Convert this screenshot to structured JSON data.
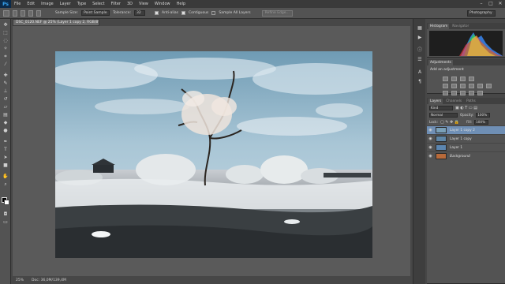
{
  "app": {
    "logo": "Ps"
  },
  "menu": [
    "File",
    "Edit",
    "Image",
    "Layer",
    "Type",
    "Select",
    "Filter",
    "3D",
    "View",
    "Window",
    "Help"
  ],
  "window_controls": {
    "minimize": "–",
    "maximize": "□",
    "close": "✕"
  },
  "options_bar": {
    "sample_size_label": "Sample Size:",
    "sample_size_value": "Point Sample",
    "tolerance_label": "Tolerance:",
    "tolerance_value": "32",
    "anti_alias_label": "Anti-alias",
    "anti_alias_checked": true,
    "contiguous_label": "Contiguous",
    "contiguous_checked": true,
    "sample_all_layers_label": "Sample All Layers",
    "sample_all_layers_checked": false,
    "refine_edge_label": "Refine Edge...",
    "workspace": "Photography"
  },
  "document": {
    "tab_title": "DSC_0120.NEF @ 25% (Layer 1 copy 2, RGB/8*) *",
    "zoom": "25%",
    "doc_size": "Doc: 36,0M/139,4M"
  },
  "panels": {
    "histogram_tab": "Histogram",
    "navigator_tab": "Navigator",
    "adjustments_tab": "Adjustments",
    "add_adjustment": "Add an adjustment",
    "layers_tab": "Layers",
    "channels_tab": "Channels",
    "paths_tab": "Paths",
    "filter_kind": "Kind",
    "blend_mode": "Normal",
    "opacity_label": "Opacity:",
    "opacity_value": "100%",
    "lock_label": "Lock:",
    "fill_label": "Fill:",
    "fill_value": "100%"
  },
  "layers": [
    {
      "name": "Layer 1 copy 2",
      "selected": true,
      "thumb": "#7aa0b8",
      "italic": false
    },
    {
      "name": "Layer 1 copy",
      "selected": false,
      "thumb": "#5f86a6",
      "italic": false
    },
    {
      "name": "Layer 1",
      "selected": false,
      "thumb": "#5c86b0",
      "italic": false
    },
    {
      "name": "Background",
      "selected": false,
      "thumb": "#b86a3a",
      "italic": true
    }
  ],
  "icons": {
    "visibility": "eye-icon",
    "tools": [
      "move-icon",
      "marquee-icon",
      "lasso-icon",
      "quick-select-icon",
      "crop-icon",
      "eyedropper-icon",
      "healing-icon",
      "brush-icon",
      "stamp-icon",
      "history-brush-icon",
      "eraser-icon",
      "gradient-icon",
      "blur-icon",
      "dodge-icon",
      "pen-icon",
      "type-icon",
      "path-select-icon",
      "shape-icon",
      "hand-icon",
      "zoom-icon"
    ]
  },
  "colors": {
    "chrome_dark": "#3a3a3a",
    "panel": "#535353",
    "canvas_bg": "#5a5a5a",
    "selection": "#6f8fb5",
    "ps_blue": "#37a6f5"
  }
}
